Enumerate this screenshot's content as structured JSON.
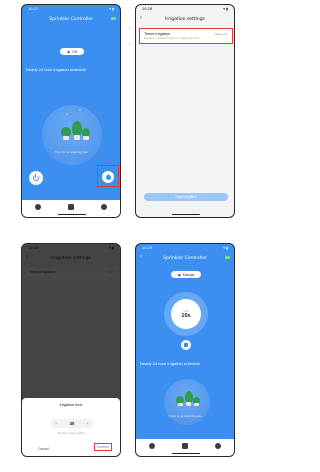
{
  "colors": {
    "primary": "#3a8ff0",
    "highlight": "#e53935",
    "plant": "#2f9c53"
  },
  "screen1": {
    "status_time": "10:27",
    "title": "Sprinkler Controller",
    "off_label": "Off",
    "schedule": "Nearly 24 hour irrigation schedule",
    "no_plan": "There is no watering plan",
    "icons": [
      "power-icon",
      "water-drop-icon",
      "watering-plan-icon",
      "document-icon",
      "settings-icon"
    ]
  },
  "screen2": {
    "status_time": "10:28",
    "title": "Irrigation settings",
    "timed_title": "Timed irrigation",
    "timed_desc": "Irrigate immediately by the set irrigation duration",
    "timed_hint": "Please set",
    "start_button": "Begin irrigation"
  },
  "screen3": {
    "status_time": "10:28",
    "title": "Irrigation settings",
    "timed_title": "Timed irrigation",
    "timed_hint": "10 >",
    "sheet_title": "Irrigation time",
    "minus": "−",
    "value": "30",
    "plus": "+",
    "range": "Duration range:1~360s",
    "cancel": "Cancel",
    "confirm": "Confirm"
  },
  "screen4": {
    "status_time": "10:29",
    "title": "Sprinkler Controller",
    "mode_label": "Manual",
    "dial_label": "Left",
    "dial_value": "10s",
    "schedule": "Nearly 24 hour irrigation schedule",
    "no_plan": "There is no watering plan"
  }
}
